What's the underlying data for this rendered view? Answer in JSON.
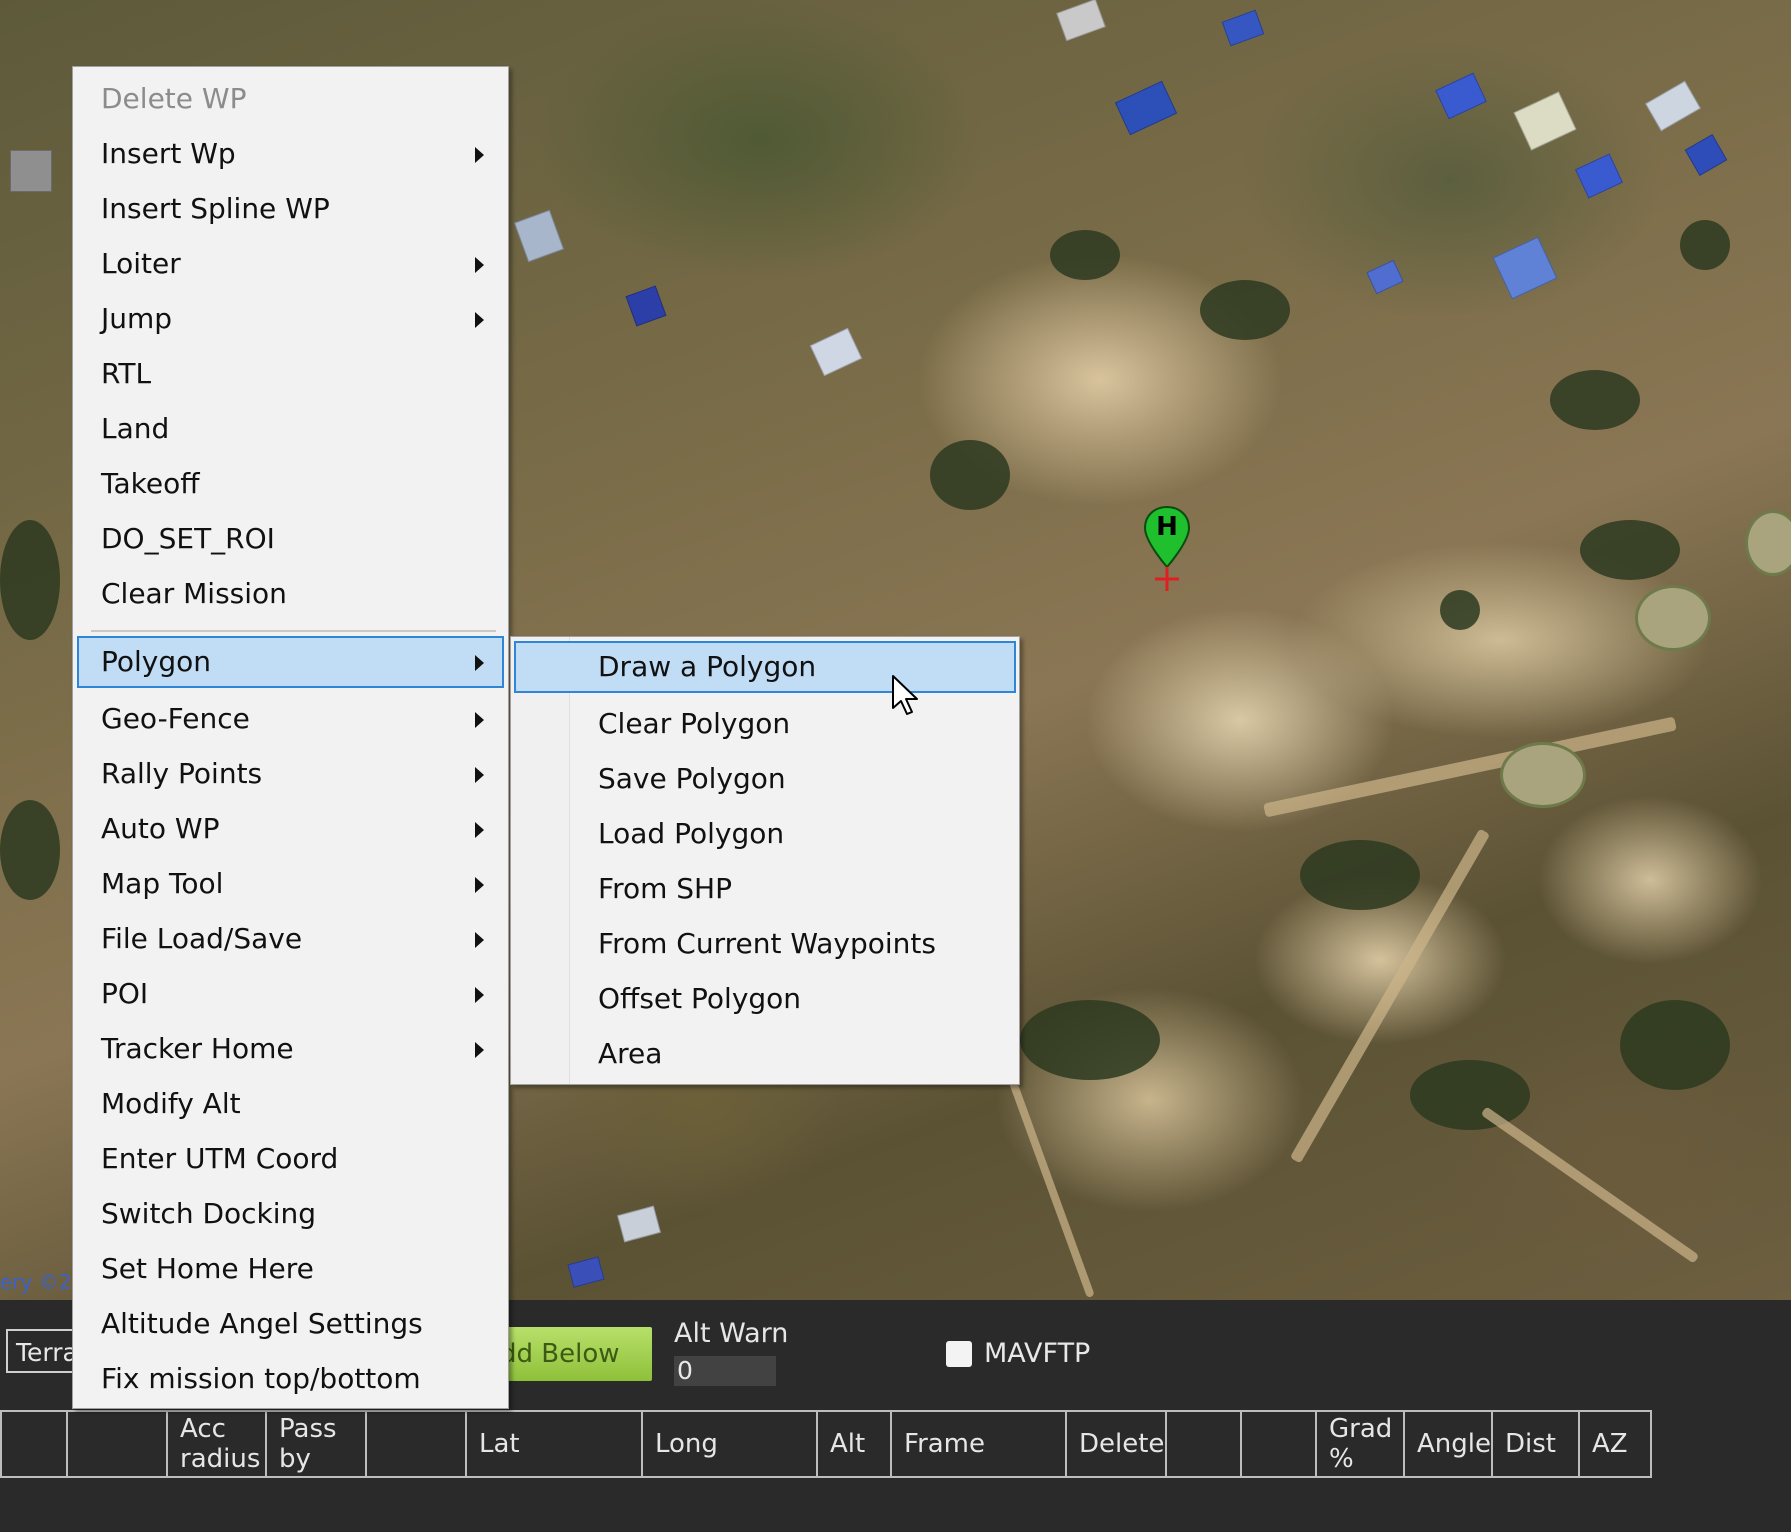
{
  "map": {
    "attribution": "ery ©2",
    "home_marker_letter": "H"
  },
  "context_menu": {
    "items": [
      {
        "label": "Delete WP",
        "has_submenu": false,
        "disabled": true
      },
      {
        "label": "Insert Wp",
        "has_submenu": true
      },
      {
        "label": "Insert Spline WP",
        "has_submenu": false
      },
      {
        "label": "Loiter",
        "has_submenu": true
      },
      {
        "label": "Jump",
        "has_submenu": true
      },
      {
        "label": "RTL",
        "has_submenu": false
      },
      {
        "label": "Land",
        "has_submenu": false
      },
      {
        "label": "Takeoff",
        "has_submenu": false
      },
      {
        "label": "DO_SET_ROI",
        "has_submenu": false
      },
      {
        "label": "Clear Mission",
        "has_submenu": false
      },
      {
        "label": "Polygon",
        "has_submenu": true,
        "selected": true
      },
      {
        "label": "Geo-Fence",
        "has_submenu": true
      },
      {
        "label": "Rally Points",
        "has_submenu": true
      },
      {
        "label": "Auto WP",
        "has_submenu": true
      },
      {
        "label": "Map Tool",
        "has_submenu": true
      },
      {
        "label": "File Load/Save",
        "has_submenu": true
      },
      {
        "label": "POI",
        "has_submenu": true
      },
      {
        "label": "Tracker Home",
        "has_submenu": true
      },
      {
        "label": "Modify Alt",
        "has_submenu": false
      },
      {
        "label": "Enter UTM Coord",
        "has_submenu": false
      },
      {
        "label": "Switch Docking",
        "has_submenu": false
      },
      {
        "label": "Set Home Here",
        "has_submenu": false
      },
      {
        "label": "Altitude Angel Settings",
        "has_submenu": false
      },
      {
        "label": "Fix mission top/bottom",
        "has_submenu": false
      }
    ]
  },
  "polygon_submenu": {
    "items": [
      {
        "label": "Draw a Polygon",
        "selected": true
      },
      {
        "label": "Clear Polygon"
      },
      {
        "label": "Save Polygon"
      },
      {
        "label": "Load Polygon"
      },
      {
        "label": "From SHP"
      },
      {
        "label": "From Current Waypoints"
      },
      {
        "label": "Offset Polygon"
      },
      {
        "label": "Area"
      }
    ]
  },
  "panel": {
    "terrain_label": "Terra",
    "add_below_label": "dd Below",
    "alt_warn_label": "Alt Warn",
    "alt_warn_value": "0",
    "mavftp_label": "MAVFTP"
  },
  "waypoint_grid": {
    "columns": [
      {
        "label": ""
      },
      {
        "label": ""
      },
      {
        "line1": "Acc",
        "line2": "radius"
      },
      {
        "line1": "Pass",
        "line2": "by"
      },
      {
        "label": ""
      },
      {
        "label": "Lat"
      },
      {
        "label": "Long"
      },
      {
        "label": "Alt"
      },
      {
        "label": "Frame"
      },
      {
        "label": "Delete"
      },
      {
        "label": ""
      },
      {
        "label": ""
      },
      {
        "line1": "Grad",
        "line2": "%"
      },
      {
        "label": "Angle"
      },
      {
        "label": "Dist"
      },
      {
        "label": "AZ"
      }
    ]
  },
  "colors": {
    "menu_highlight": "#c1dcf5",
    "menu_highlight_border": "#2f86d6",
    "add_below_button": "#a3d44f",
    "home_marker": "#1fbf2e"
  }
}
